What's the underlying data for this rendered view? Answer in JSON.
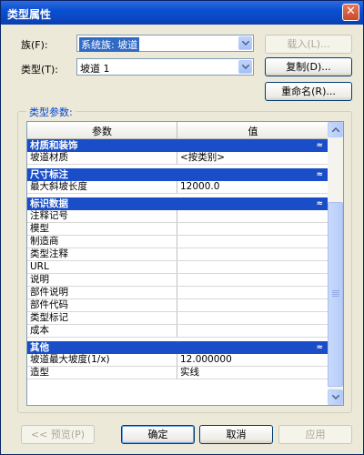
{
  "window": {
    "title": "类型属性",
    "close_glyph": "✕"
  },
  "family": {
    "label": "族(F):",
    "value": "系统族: 坡道"
  },
  "type": {
    "label": "类型(T):",
    "value": "坡道 1"
  },
  "buttons": {
    "load": "载入(L)...",
    "duplicate": "复制(D)...",
    "rename": "重命名(R)...",
    "preview": "<< 预览(P)",
    "ok": "确定",
    "cancel": "取消",
    "apply": "应用"
  },
  "type_params": {
    "label": "类型参数:",
    "col_param": "参数",
    "col_value": "值",
    "categories": [
      {
        "name": "材质和装饰",
        "rows": [
          {
            "p": "坡道材质",
            "v": "<按类别>"
          }
        ]
      },
      {
        "name": "尺寸标注",
        "rows": [
          {
            "p": "最大斜坡长度",
            "v": "12000.0"
          }
        ]
      },
      {
        "name": "标识数据",
        "rows": [
          {
            "p": "注释记号",
            "v": ""
          },
          {
            "p": "模型",
            "v": ""
          },
          {
            "p": "制造商",
            "v": ""
          },
          {
            "p": "类型注释",
            "v": ""
          },
          {
            "p": "URL",
            "v": ""
          },
          {
            "p": "说明",
            "v": ""
          },
          {
            "p": "部件说明",
            "v": ""
          },
          {
            "p": "部件代码",
            "v": ""
          },
          {
            "p": "类型标记",
            "v": ""
          },
          {
            "p": "成本",
            "v": ""
          }
        ]
      },
      {
        "name": "其他",
        "rows": [
          {
            "p": "坡道最大坡度(1/x)",
            "v": "12.000000"
          },
          {
            "p": "造型",
            "v": "实线"
          }
        ]
      }
    ],
    "collapse_glyph": "≈"
  },
  "colors": {
    "title_bar": "#0A4FD0",
    "category_header": "#1A4EC8",
    "dialog_bg": "#ECE9D8"
  }
}
